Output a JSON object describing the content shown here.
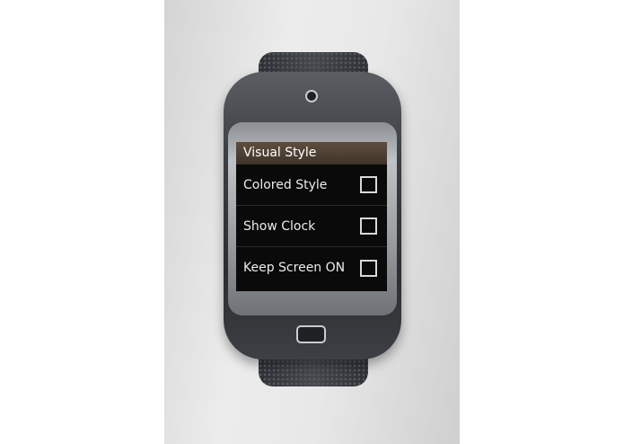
{
  "screen": {
    "title": "Visual Style",
    "items": [
      {
        "label": "Colored Style",
        "checked": false
      },
      {
        "label": "Show Clock",
        "checked": false
      },
      {
        "label": "Keep Screen ON",
        "checked": false
      }
    ]
  },
  "colors": {
    "header_bg": "#4f4134",
    "screen_bg": "#0a0a0a",
    "text": "#ececec"
  }
}
